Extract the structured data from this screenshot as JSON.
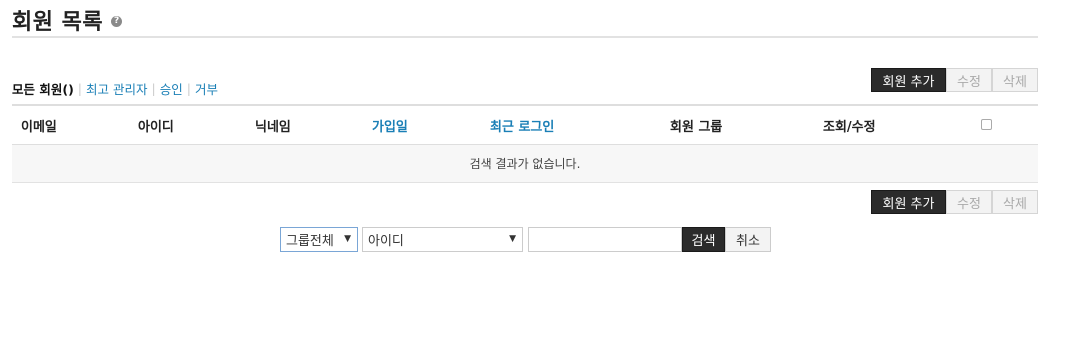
{
  "page": {
    "title": "회원 목록",
    "help_icon": "?"
  },
  "filters": {
    "current": "모든 회원()",
    "links": [
      "최고 관리자",
      "승인",
      "거부"
    ]
  },
  "actions": {
    "add": "회원 추가",
    "edit": "수정",
    "delete": "삭제"
  },
  "table": {
    "columns": [
      "이메일",
      "아이디",
      "닉네임",
      "가입일",
      "최근 로그인",
      "회원 그룹",
      "조회/수정"
    ],
    "empty_message": "검색 결과가 없습니다."
  },
  "search": {
    "group_select": "그룹전체",
    "field_select": "아이디",
    "query": "",
    "submit": "검색",
    "cancel": "취소"
  },
  "colors": {
    "link": "#1a7fb6",
    "dark_button": "#2b2b2b"
  }
}
